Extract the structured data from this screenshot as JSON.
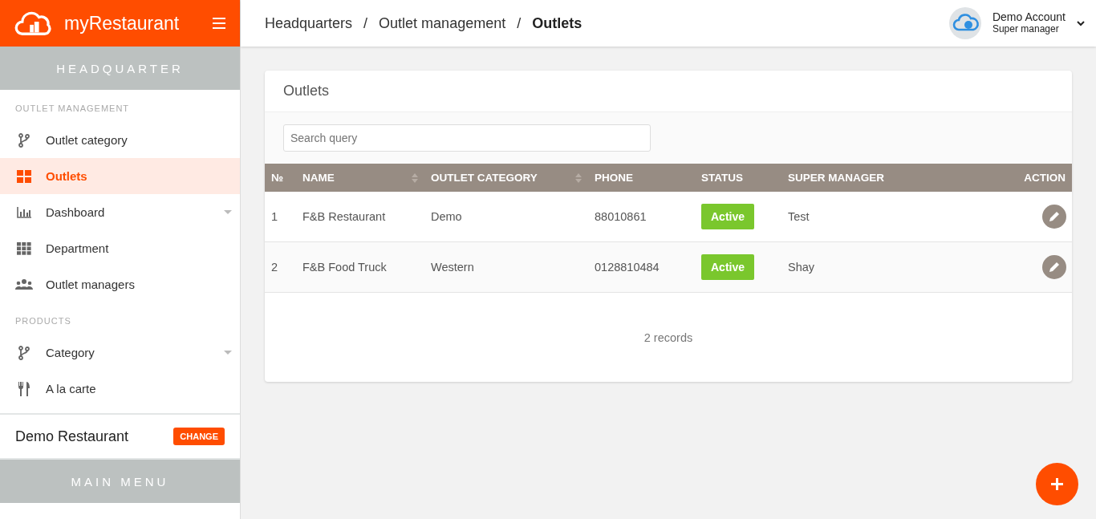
{
  "brand": {
    "name": "myRestaurant"
  },
  "breadcrumb": [
    {
      "label": "Headquarters",
      "current": false
    },
    {
      "label": "Outlet management",
      "current": false
    },
    {
      "label": "Outlets",
      "current": true
    }
  ],
  "breadcrumb_separators": [
    "/",
    "/"
  ],
  "account": {
    "name": "Demo Account",
    "role": "Super manager"
  },
  "sidebar": {
    "band": "HEADQUARTER",
    "sections": [
      {
        "title": "OUTLET MANAGEMENT",
        "items": [
          {
            "label": "Outlet category",
            "selected": false,
            "expandable": false
          },
          {
            "label": "Outlets",
            "selected": true,
            "expandable": false
          },
          {
            "label": "Dashboard",
            "selected": false,
            "expandable": true
          },
          {
            "label": "Department",
            "selected": false,
            "expandable": false
          },
          {
            "label": "Outlet managers",
            "selected": false,
            "expandable": false
          }
        ]
      },
      {
        "title": "PRODUCTS",
        "items": [
          {
            "label": "Category",
            "selected": false,
            "expandable": true
          },
          {
            "label": "A la carte",
            "selected": false,
            "expandable": false
          }
        ]
      }
    ],
    "restaurant": {
      "name": "Demo Restaurant",
      "button": "CHANGE"
    },
    "band2": "MAIN MENU"
  },
  "card": {
    "title": "Outlets",
    "search": {
      "placeholder": "Search query"
    },
    "table": {
      "columns": [
        {
          "label": "№",
          "sortable": false
        },
        {
          "label": "NAME",
          "sortable": true
        },
        {
          "label": "OUTLET CATEGORY",
          "sortable": true
        },
        {
          "label": "PHONE",
          "sortable": false
        },
        {
          "label": "STATUS",
          "sortable": false
        },
        {
          "label": "SUPER MANAGER",
          "sortable": false
        },
        {
          "label": "ACTION",
          "sortable": false
        }
      ],
      "rows": [
        {
          "no": "1",
          "name": "F&B Restaurant",
          "category": "Demo",
          "phone": "88010861",
          "status": "Active",
          "manager": "Test"
        },
        {
          "no": "2",
          "name": "F&B Food Truck",
          "category": "Western",
          "phone": "0128810484",
          "status": "Active",
          "manager": "Shay"
        }
      ]
    },
    "footer": "2 records"
  }
}
